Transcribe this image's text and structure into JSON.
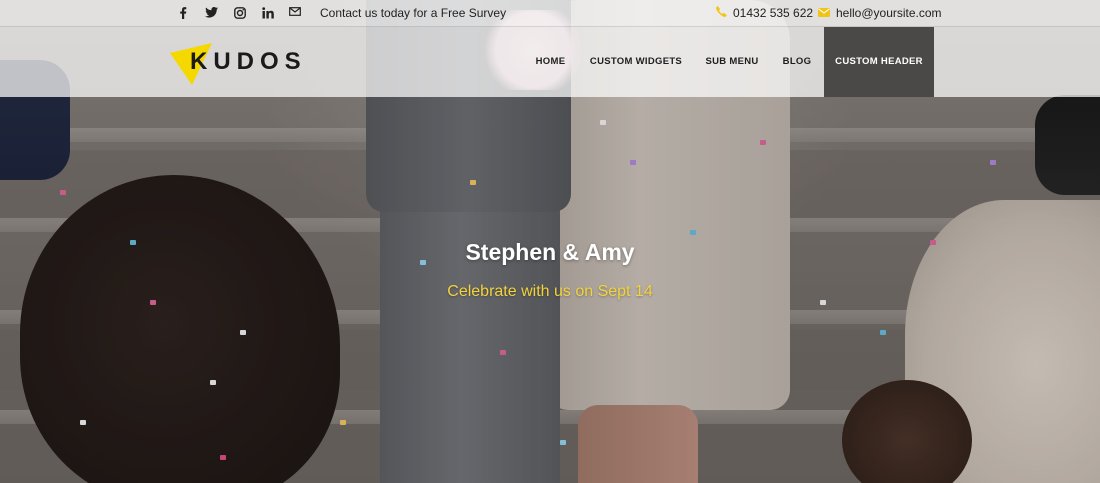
{
  "topbar": {
    "social_icons": [
      "facebook-icon",
      "twitter-icon",
      "instagram-icon",
      "linkedin-icon",
      "mail-icon"
    ],
    "tagline": "Contact us today for a Free Survey",
    "phone": "01432 535 622",
    "email": "hello@yoursite.com"
  },
  "navbar": {
    "logo_text": "KUDOS",
    "items": [
      {
        "label": "HOME"
      },
      {
        "label": "CUSTOM WIDGETS"
      },
      {
        "label": "SUB MENU"
      },
      {
        "label": "BLOG"
      },
      {
        "label": "CUSTOM HEADER",
        "active": true
      }
    ]
  },
  "hero": {
    "title": "Stephen & Amy",
    "subtitle": "Celebrate with us on Sept 14"
  },
  "colors": {
    "accent_yellow": "#f3d23a",
    "logo_yellow": "#f5d800",
    "active_nav_bg": "#4b4948",
    "topbar_icon_yellow": "#f0c419"
  }
}
